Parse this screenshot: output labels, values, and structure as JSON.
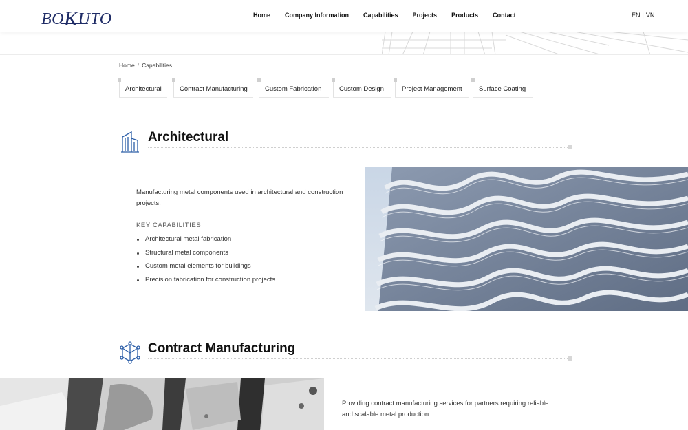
{
  "header": {
    "logo_text_a": "BO",
    "logo_text_k": "K",
    "logo_text_b": "UTO",
    "nav": [
      "Home",
      "Company Information",
      "Capabilities",
      "Projects",
      "Products",
      "Contact"
    ],
    "lang_active": "EN",
    "lang_sep": "|",
    "lang_other": "VN"
  },
  "breadcrumb": {
    "home": "Home",
    "sep": "/",
    "current": "Capabilities"
  },
  "tabs": [
    "Architectural",
    "Contract Manufacturing",
    "Custom Fabrication",
    "Custom Design",
    "Project Management",
    "Surface Coating"
  ],
  "sections": {
    "architectural": {
      "title": "Architectural",
      "icon": "building-icon",
      "description": "Manufacturing metal components used in architectural and construction projects.",
      "key_capabilities_title": "KEY CAPABILITIES",
      "capabilities": [
        "Architectural metal fabrication",
        "Structural metal components",
        "Custom metal elements for buildings",
        "Precision fabrication for construction projects"
      ]
    },
    "contract_manufacturing": {
      "title": "Contract Manufacturing",
      "icon": "cube-network-icon",
      "description": "Providing contract manufacturing services for partners requiring reliable and scalable metal production."
    }
  },
  "colors": {
    "brand": "#1f2c66",
    "accent_icon": "#2d5fa8",
    "text": "#222222",
    "rule": "#d7d7d7"
  }
}
